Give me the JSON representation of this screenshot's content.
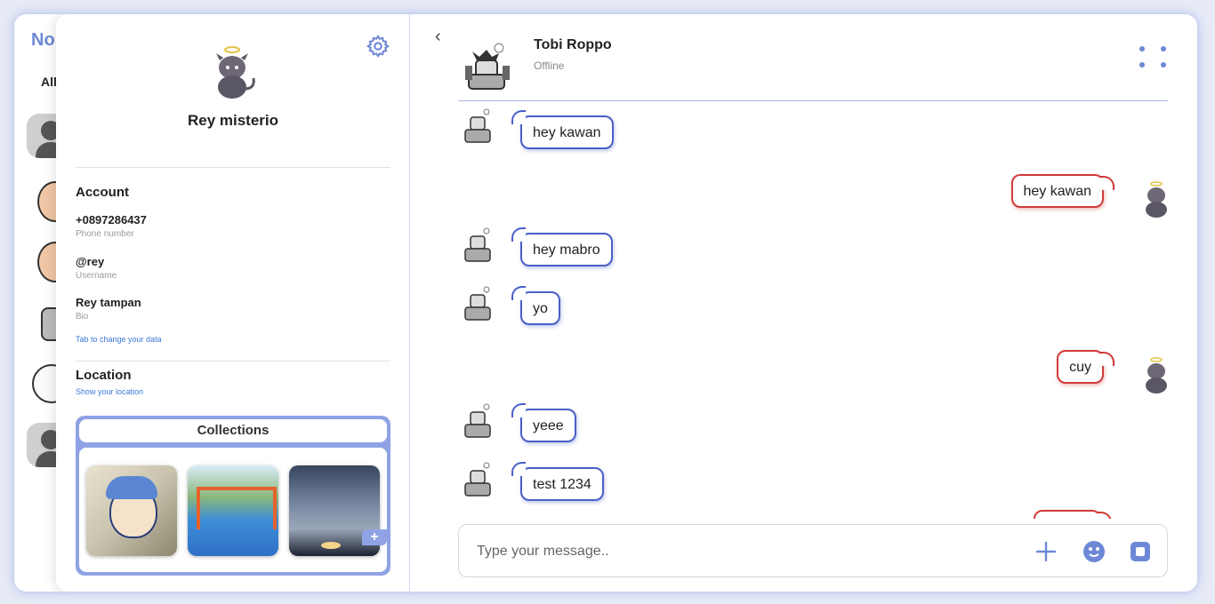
{
  "background_list": {
    "title": "No",
    "filter_label": "All"
  },
  "profile": {
    "name": "Rey misterio",
    "account": {
      "title": "Account",
      "phone": "+0897286437",
      "phone_label": "Phone number",
      "username": "@rey",
      "username_label": "Username",
      "bio": "Rey tampan",
      "bio_label": "Bio",
      "change_link": "Tab to change your data"
    },
    "location": {
      "title": "Location",
      "link": "Show your location"
    },
    "collections": {
      "title": "Collections",
      "add_label": "+"
    }
  },
  "chat": {
    "contact_name": "Tobi Roppo",
    "contact_status": "Offline",
    "messages": [
      {
        "text": "hey kawan",
        "from": "in"
      },
      {
        "text": "hey kawan",
        "from": "out"
      },
      {
        "text": "hey mabro",
        "from": "in"
      },
      {
        "text": "yo",
        "from": "in"
      },
      {
        "text": "cuy",
        "from": "out"
      },
      {
        "text": "yeee",
        "from": "in"
      },
      {
        "text": "test 1234",
        "from": "in"
      }
    ],
    "composer": {
      "placeholder": "Type your message.."
    }
  },
  "colors": {
    "accent": "#6d88d6",
    "incoming": "#4a5fc6",
    "outgoing": "#d13a3a"
  }
}
